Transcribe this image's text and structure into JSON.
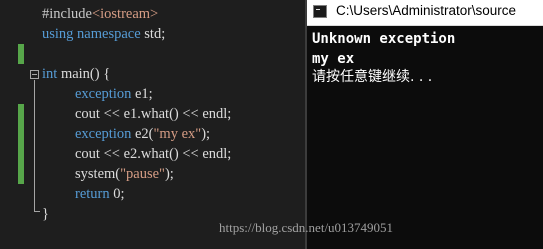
{
  "editor": {
    "lines": [
      {
        "a": "#include",
        "b": "<iostream>"
      },
      {
        "a": "using",
        "b": " namespace",
        "c": " std;"
      },
      {
        "a": ""
      },
      {
        "a": "int",
        "b": " main() {"
      },
      {
        "a": "exception",
        "b": " e1;"
      },
      {
        "a": "cout << e1.what() << endl;"
      },
      {
        "a": "exception",
        "b": " e2(",
        "c": "\"my ex\"",
        "d": ");"
      },
      {
        "a": "cout << e2.what() << endl;"
      },
      {
        "a": "system(",
        "b": "\"pause\"",
        "c": ");"
      },
      {
        "a": "return",
        "b": " 0;"
      },
      {
        "a": "}"
      }
    ]
  },
  "console": {
    "title": "C:\\Users\\Administrator\\source",
    "output": [
      "Unknown exception",
      "my ex",
      "请按任意键继续. . ."
    ]
  },
  "watermark": "https://blog.csdn.net/u013749051",
  "colors": {
    "keyword": "#569cd6",
    "string": "#d69d85",
    "text": "#dcdcdc",
    "gutter_changed": "#57a64a",
    "background": "#1e1e1e"
  }
}
